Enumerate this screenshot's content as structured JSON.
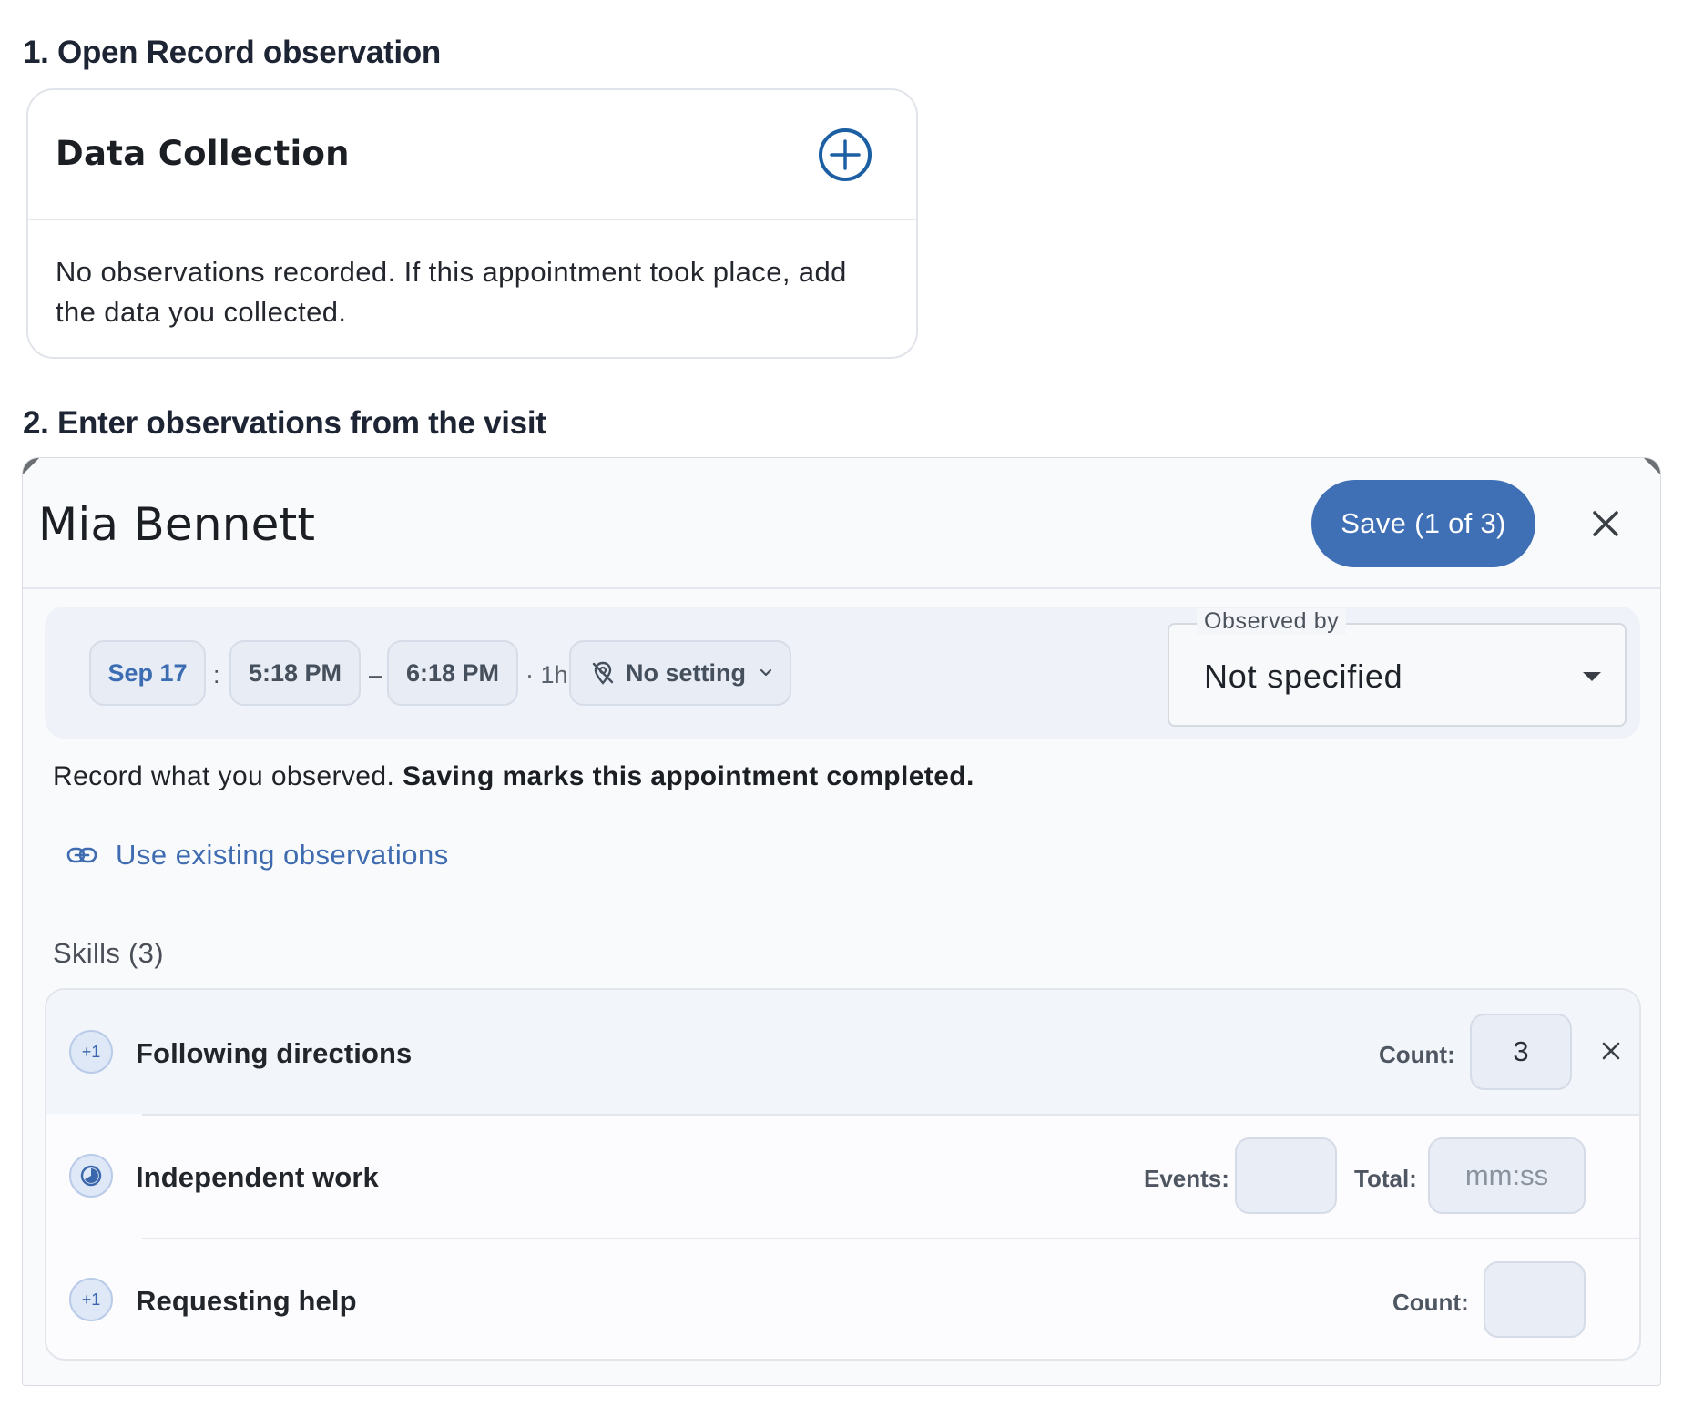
{
  "steps": {
    "step1": "1. Open Record observation",
    "step2": "2. Enter observations from the visit"
  },
  "data_collection": {
    "title": "Data Collection",
    "add_icon": "plus-circle-icon",
    "empty_text": "No observations recorded. If this appointment took place, add the data you collected."
  },
  "modal": {
    "patient_name": "Mia Bennett",
    "save_label": "Save (1 of 3)",
    "close_icon": "close-icon",
    "date": "Sep 17",
    "colon": ":",
    "start_time": "5:18 PM",
    "dash": "–",
    "end_time": "6:18 PM",
    "duration": "· 1h",
    "setting": "No setting",
    "observed_by": {
      "label": "Observed by",
      "value": "Not specified"
    },
    "record_text": "Record what you observed.",
    "record_bold": "Saving marks this appointment completed.",
    "use_existing": "Use existing observations",
    "skills_heading": "Skills (3)",
    "skills": [
      {
        "name": "Following directions",
        "icon": "+1",
        "count_label": "Count:",
        "count_value": "3"
      },
      {
        "name": "Independent work",
        "events_label": "Events:",
        "events_value": "",
        "total_label": "Total:",
        "total_placeholder": "mm:ss"
      },
      {
        "name": "Requesting help",
        "icon": "+1",
        "count_label": "Count:",
        "count_value": ""
      }
    ]
  },
  "colors": {
    "accent": "#3f6fb5",
    "link": "#3f6cb1",
    "icon_blue": "#1c5fa3"
  }
}
